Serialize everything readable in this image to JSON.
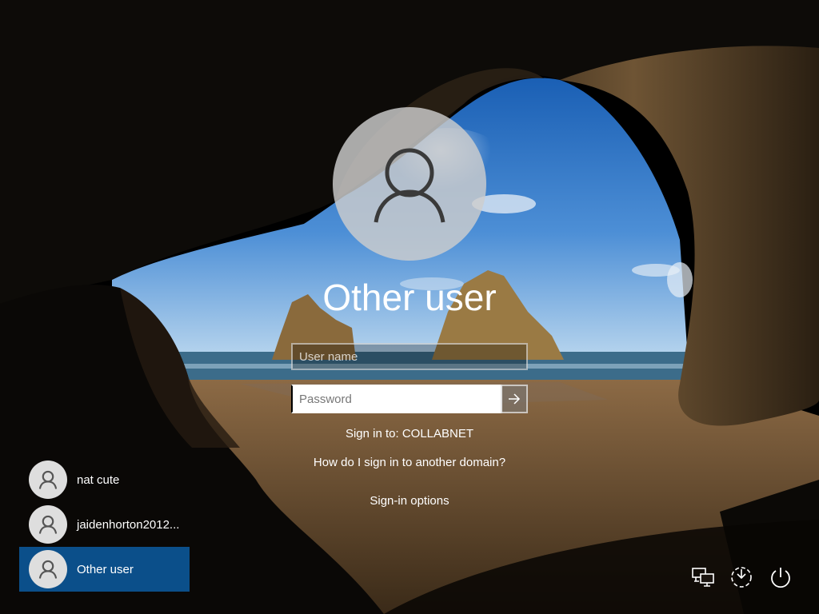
{
  "selected_user": {
    "name": "Other user",
    "avatar_icon": "user-icon"
  },
  "form": {
    "username_placeholder": "User name",
    "password_placeholder": "Password",
    "submit_icon": "arrow-right-icon"
  },
  "signin_to": "Sign in to: COLLABNET",
  "another_domain_link": "How do I sign in to another domain?",
  "signin_options_link": "Sign-in options",
  "users": [
    {
      "name": "nat cute",
      "selected": false
    },
    {
      "name": "jaidenhorton2012...",
      "selected": false
    },
    {
      "name": "Other user",
      "selected": true
    }
  ],
  "system_icons": [
    "network-icon",
    "ease-of-access-icon",
    "power-icon"
  ],
  "colors": {
    "selected_tile": "#0b4f8a",
    "avatar_bg": "#dedede"
  }
}
